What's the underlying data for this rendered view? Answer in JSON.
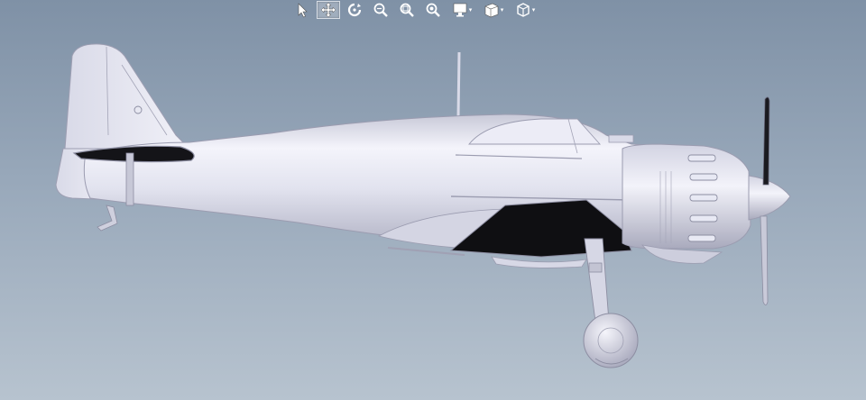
{
  "toolbar": {
    "tools": [
      {
        "name": "select-tool",
        "icon": "arrow-cursor-icon",
        "active": false,
        "dropdown": false
      },
      {
        "name": "pan-tool",
        "icon": "move-arrows-icon",
        "active": true,
        "dropdown": false
      },
      {
        "name": "rotate-tool",
        "icon": "rotate-icon",
        "active": false,
        "dropdown": false
      },
      {
        "name": "zoom-tool",
        "icon": "zoom-icon",
        "active": false,
        "dropdown": false
      },
      {
        "name": "zoom-in-tool",
        "icon": "zoom-in-icon",
        "active": false,
        "dropdown": false
      },
      {
        "name": "zoom-fit-tool",
        "icon": "zoom-fit-icon",
        "active": false,
        "dropdown": false
      },
      {
        "name": "display-mode-tool",
        "icon": "monitor-icon",
        "active": false,
        "dropdown": true
      },
      {
        "name": "section-view-tool",
        "icon": "section-box-icon",
        "active": false,
        "dropdown": true
      },
      {
        "name": "view-orientation-tool",
        "icon": "cube-icon",
        "active": false,
        "dropdown": true
      }
    ],
    "caret": "▾"
  },
  "viewport": {
    "background_top": "#7f91a6",
    "background_bottom": "#b7c3cf",
    "model": "aircraft-3d-model",
    "model_color": "#e4e5f2"
  }
}
